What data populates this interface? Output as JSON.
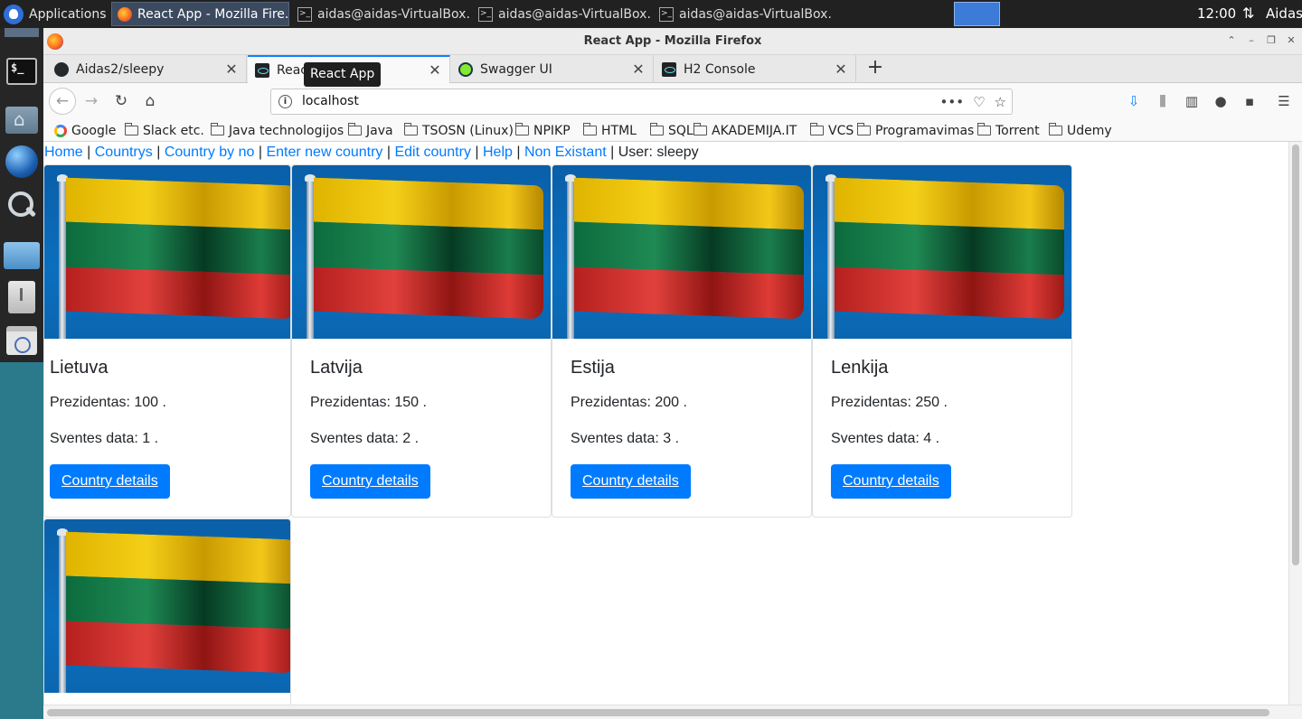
{
  "panel": {
    "applications_label": "Applications",
    "tasks": [
      {
        "label": "React App - Mozilla Fire...",
        "icon": "firefox-icon",
        "active": true
      },
      {
        "label": "aidas@aidas-VirtualBox...",
        "icon": "terminal-icon",
        "active": false
      },
      {
        "label": "aidas@aidas-VirtualBox...",
        "icon": "terminal-icon",
        "active": false
      },
      {
        "label": "aidas@aidas-VirtualBox...",
        "icon": "terminal-icon",
        "active": false
      }
    ],
    "clock": "12:00",
    "user": "Aidas"
  },
  "window": {
    "title": "React App - Mozilla Firefox"
  },
  "tabs": [
    {
      "label": "Aidas2/sleepy",
      "icon": "github-icon",
      "active": false
    },
    {
      "label": "React App",
      "icon": "react-icon",
      "active": true
    },
    {
      "label": "Swagger UI",
      "icon": "swagger-icon",
      "active": false
    },
    {
      "label": "H2 Console",
      "icon": "react-icon",
      "active": false
    }
  ],
  "urlbar": {
    "url": "localhost",
    "tooltip": "React App"
  },
  "bookmarks": [
    {
      "label": "Google",
      "icon": "google-icon"
    },
    {
      "label": "Slack etc.",
      "icon": "folder-icon"
    },
    {
      "label": "Java technologijos",
      "icon": "folder-icon"
    },
    {
      "label": "Java",
      "icon": "folder-icon"
    },
    {
      "label": "TSOSN (Linux)",
      "icon": "folder-icon"
    },
    {
      "label": "NPIKP",
      "icon": "folder-icon"
    },
    {
      "label": "HTML",
      "icon": "folder-icon"
    },
    {
      "label": "SQL",
      "icon": "folder-icon"
    },
    {
      "label": "AKADEMIJA.IT",
      "icon": "folder-icon"
    },
    {
      "label": "VCS",
      "icon": "folder-icon"
    },
    {
      "label": "Programavimas",
      "icon": "folder-icon"
    },
    {
      "label": "Torrent",
      "icon": "folder-icon"
    },
    {
      "label": "Udemy",
      "icon": "folder-icon"
    }
  ],
  "app_nav": {
    "links": [
      "Home",
      "Countrys",
      "Country by no",
      "Enter new country",
      "Edit country",
      "Help",
      "Non Existant"
    ],
    "user_text": "User: sleepy"
  },
  "countries": [
    {
      "name": "Lietuva",
      "president_line": "Prezidentas: 100 .",
      "holiday_line": "Sventes data: 1 .",
      "button": "Country details"
    },
    {
      "name": "Latvija",
      "president_line": "Prezidentas: 150 .",
      "holiday_line": "Sventes data: 2 .",
      "button": "Country details"
    },
    {
      "name": "Estija",
      "president_line": "Prezidentas: 200 .",
      "holiday_line": "Sventes data: 3 .",
      "button": "Country details"
    },
    {
      "name": "Lenkija",
      "president_line": "Prezidentas: 250 .",
      "holiday_line": "Sventes data: 4 .",
      "button": "Country details"
    }
  ],
  "colors": {
    "link": "#007bff",
    "button": "#007bff",
    "accent_tab": "#0a84ff"
  }
}
